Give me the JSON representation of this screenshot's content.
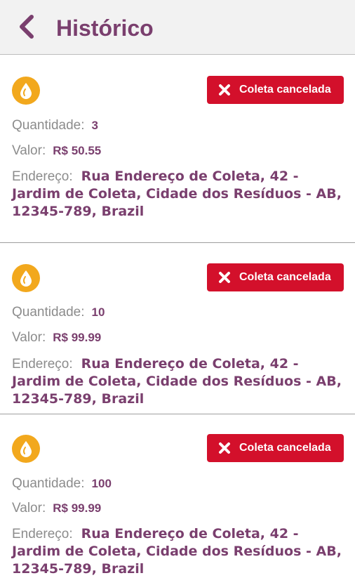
{
  "header": {
    "title": "Histórico",
    "back_icon": "chevron-left-icon"
  },
  "colors": {
    "accent": "#7a3f6e",
    "status_bg": "#d3102b",
    "drop": "#f2a81d"
  },
  "labels": {
    "quantity": "Quantidade:",
    "value": "Valor:",
    "address": "Endereço:"
  },
  "items": [
    {
      "status": "Coleta cancelada",
      "quantity": "3",
      "value": "R$ 50.55",
      "address": "Rua Endereço de Coleta, 42 - Jardim de Coleta, Cidade dos Resíduos - AB, 12345-789, Brazil"
    },
    {
      "status": "Coleta cancelada",
      "quantity": "10",
      "value": "R$ 99.99",
      "address": "Rua Endereço de Coleta, 42 - Jardim de Coleta, Cidade dos Resíduos - AB, 12345-789, Brazil"
    },
    {
      "status": "Coleta cancelada",
      "quantity": "100",
      "value": "R$ 99.99",
      "address": "Rua Endereço de Coleta, 42 - Jardim de Coleta, Cidade dos Resíduos - AB, 12345-789, Brazil"
    }
  ]
}
